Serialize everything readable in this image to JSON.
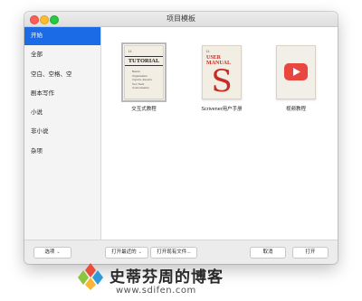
{
  "window": {
    "title": "项目模板"
  },
  "sidebar": {
    "items": [
      {
        "label": "开始",
        "active": true
      },
      {
        "label": "全部"
      },
      {
        "label": "空白、空格、空"
      },
      {
        "label": "剧本写作"
      },
      {
        "label": "小说"
      },
      {
        "label": "非小说"
      },
      {
        "label": "杂项"
      }
    ]
  },
  "templates": [
    {
      "label": "交互式教程",
      "cover": {
        "tag": "I.I.",
        "title": "TUTORIAL",
        "lines": [
          "Basics",
          "Organisation",
          "Imports, Exports",
          "Text Tools",
          "Customisation"
        ]
      }
    },
    {
      "label": "Scrivener用户手册",
      "cover": {
        "tag": "I.I.",
        "title": "USER MANUAL",
        "letter": "S"
      }
    },
    {
      "label": "视频教程",
      "cover": {
        "icon": "play-icon"
      }
    }
  ],
  "bottombar": {
    "options_label": "选项",
    "open_recent_label": "打开最近的",
    "open_existing_label": "打开现有文件...",
    "cancel_label": "取消",
    "open_label": "打开"
  },
  "watermark": {
    "name": "史蒂芬周的博客",
    "url": "www.sdifen.com"
  },
  "colors": {
    "accent": "#1b6ae6",
    "video_red": "#e8463f",
    "manual_red": "#c62d24"
  }
}
